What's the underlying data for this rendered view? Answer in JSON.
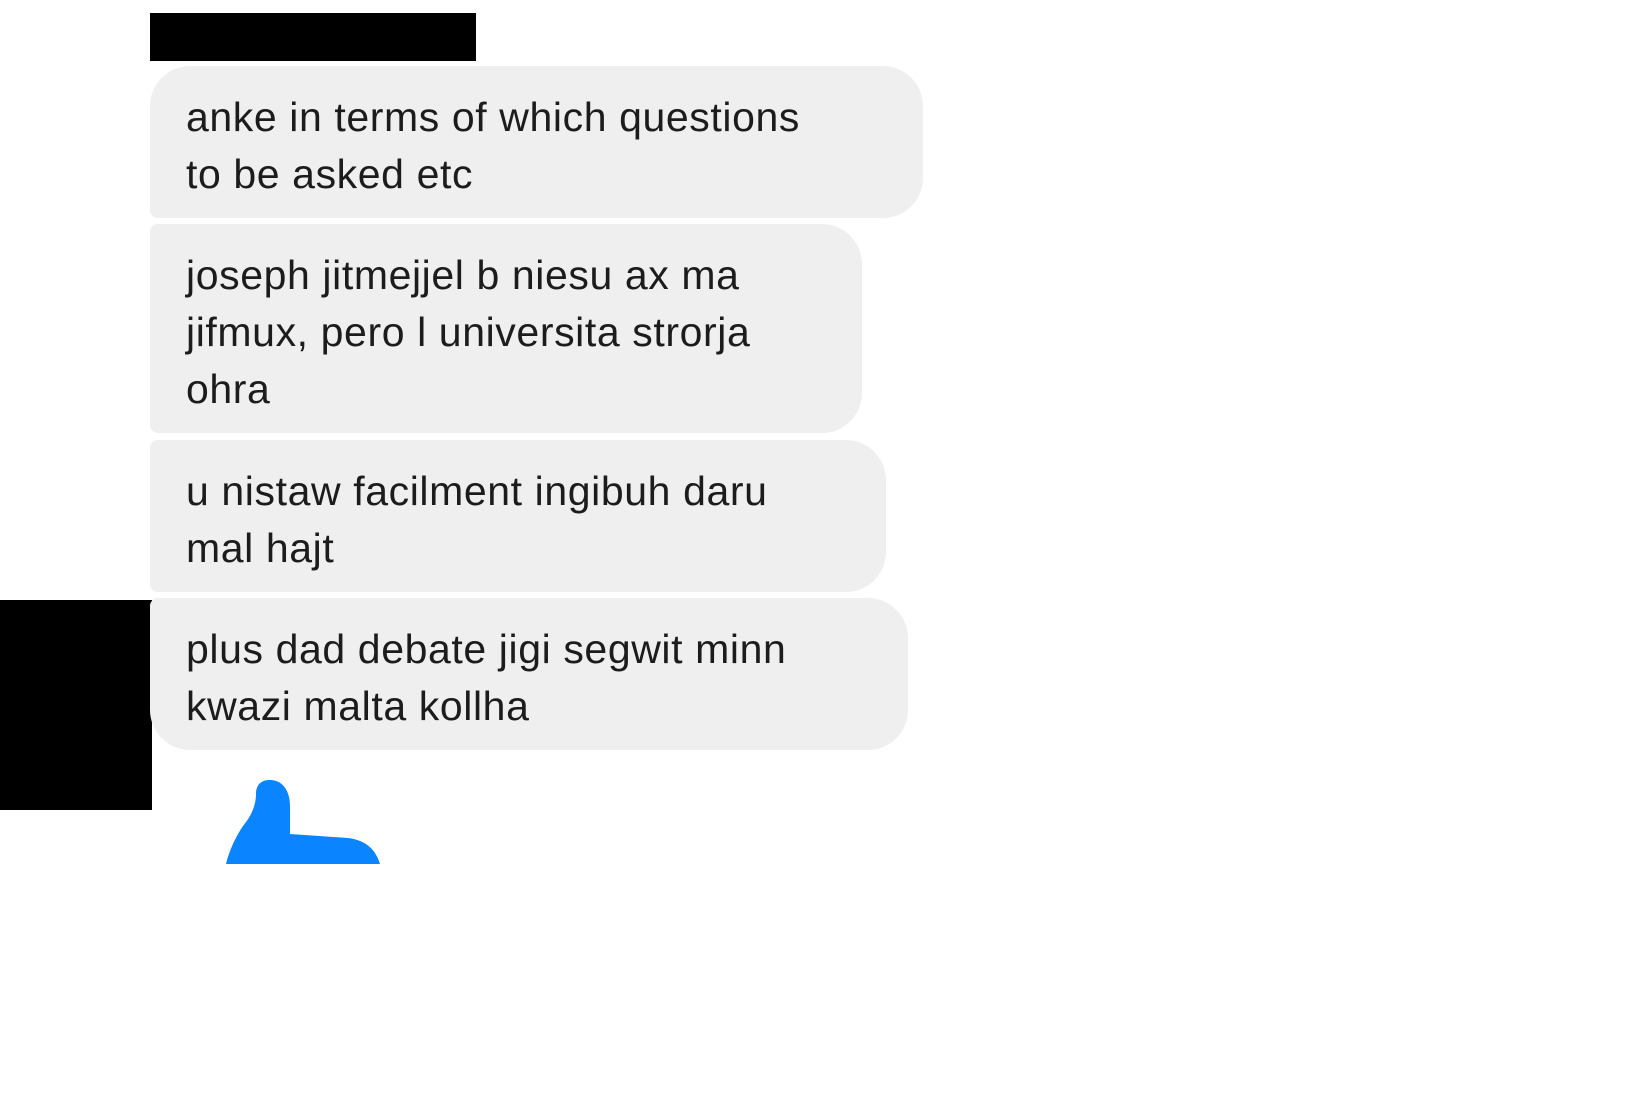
{
  "messages": [
    {
      "text": "anke in terms of which questions\nto be asked etc"
    },
    {
      "text": "joseph jitmejjel b niesu ax ma\njifmux, pero l universita strorja\nohra"
    },
    {
      "text": "u nistaw facilment ingibuh daru\nmal hajt"
    },
    {
      "text": "plus dad debate jigi segwit minn\nkwazi malta kollha"
    }
  ],
  "reaction": {
    "icon": "thumbs-up-icon",
    "color": "#0a84ff"
  },
  "colors": {
    "bubble_bg": "#efefef",
    "text": "#1c1c1c",
    "redaction": "#000000",
    "accent": "#0a84ff"
  }
}
